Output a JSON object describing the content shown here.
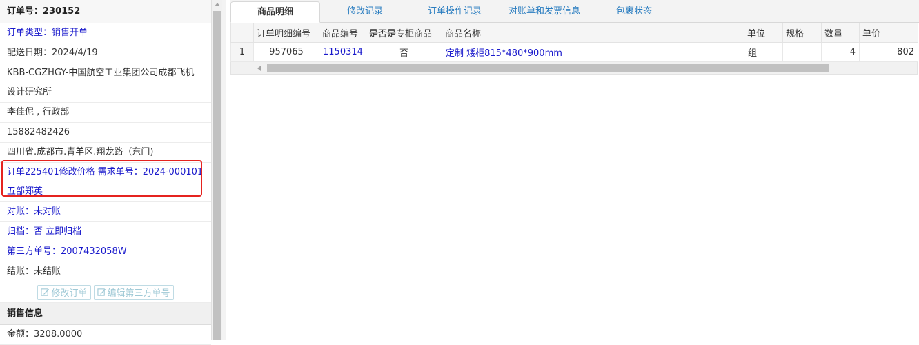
{
  "order": {
    "header": "订单号：230152",
    "type": "订单类型：销售开单",
    "delivery_date": "配送日期：2024/4/19",
    "customer_line1": "KBB-CGZHGY-中国航空工业集团公司成都飞机",
    "customer_line2": "设计研究所",
    "contact": "李佳伲 , 行政部",
    "phone": "15882482426",
    "address": "四川省.成都市.青羊区.翔龙路（东门)",
    "note_line1": "订单225401修改价格 需求单号：2024-000101",
    "note_line2": "五部郑英",
    "reconcile": "对账：未对账",
    "archive": "归档：否 立即归档",
    "third_party": "第三方单号：2007432058W",
    "settle": "结账：未结账",
    "buttons": {
      "edit_order": "修改订单",
      "edit_third_party": "编辑第三方单号"
    }
  },
  "sales": {
    "header": "销售信息",
    "amount": "金额：3208.0000"
  },
  "tabs": [
    "商品明细",
    "修改记录",
    "订单操作记录",
    "对账单和发票信息",
    "包裹状态"
  ],
  "table": {
    "headers": [
      "订单明细编号",
      "商品编号",
      "是否是专柜商品",
      "商品名称",
      "单位",
      "规格",
      "数量",
      "单价"
    ],
    "rows": [
      {
        "index": "1",
        "detail_id": "957065",
        "product_id": "1150314",
        "is_counter": "否",
        "name": "定制 矮柜815*480*900mm",
        "unit": "组",
        "spec": "",
        "qty": "4",
        "price": "802"
      }
    ]
  },
  "colors": {
    "link": "#1a1acc",
    "tab_text": "#2a7dc0",
    "highlight_frame": "#e5231f"
  }
}
